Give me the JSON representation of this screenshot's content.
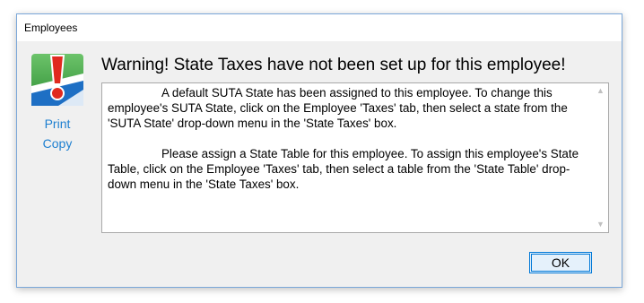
{
  "window": {
    "title": "Employees"
  },
  "sidebar": {
    "icon": "warning-exclamation-icon",
    "print_label": "Print",
    "copy_label": "Copy"
  },
  "dialog": {
    "headline": "Warning! State Taxes have not been set up for this employee!",
    "message_paragraphs": [
      "A default SUTA State has been assigned to this employee. To change this employee's SUTA State, click on the Employee 'Taxes' tab, then select a state from the 'SUTA State' drop-down menu in the 'State Taxes' box.",
      "Please assign a State Table for this employee. To assign this employee's State Table, click on the Employee 'Taxes' tab, then select a table from the 'State Table' drop-down menu in the 'State Taxes' box."
    ],
    "ok_label": "OK"
  },
  "colors": {
    "accent": "#0078d7",
    "link": "#1e7fd0",
    "icon_green": "#3a9b3c",
    "icon_red": "#e02a1f",
    "icon_blue": "#1e6fc4"
  }
}
